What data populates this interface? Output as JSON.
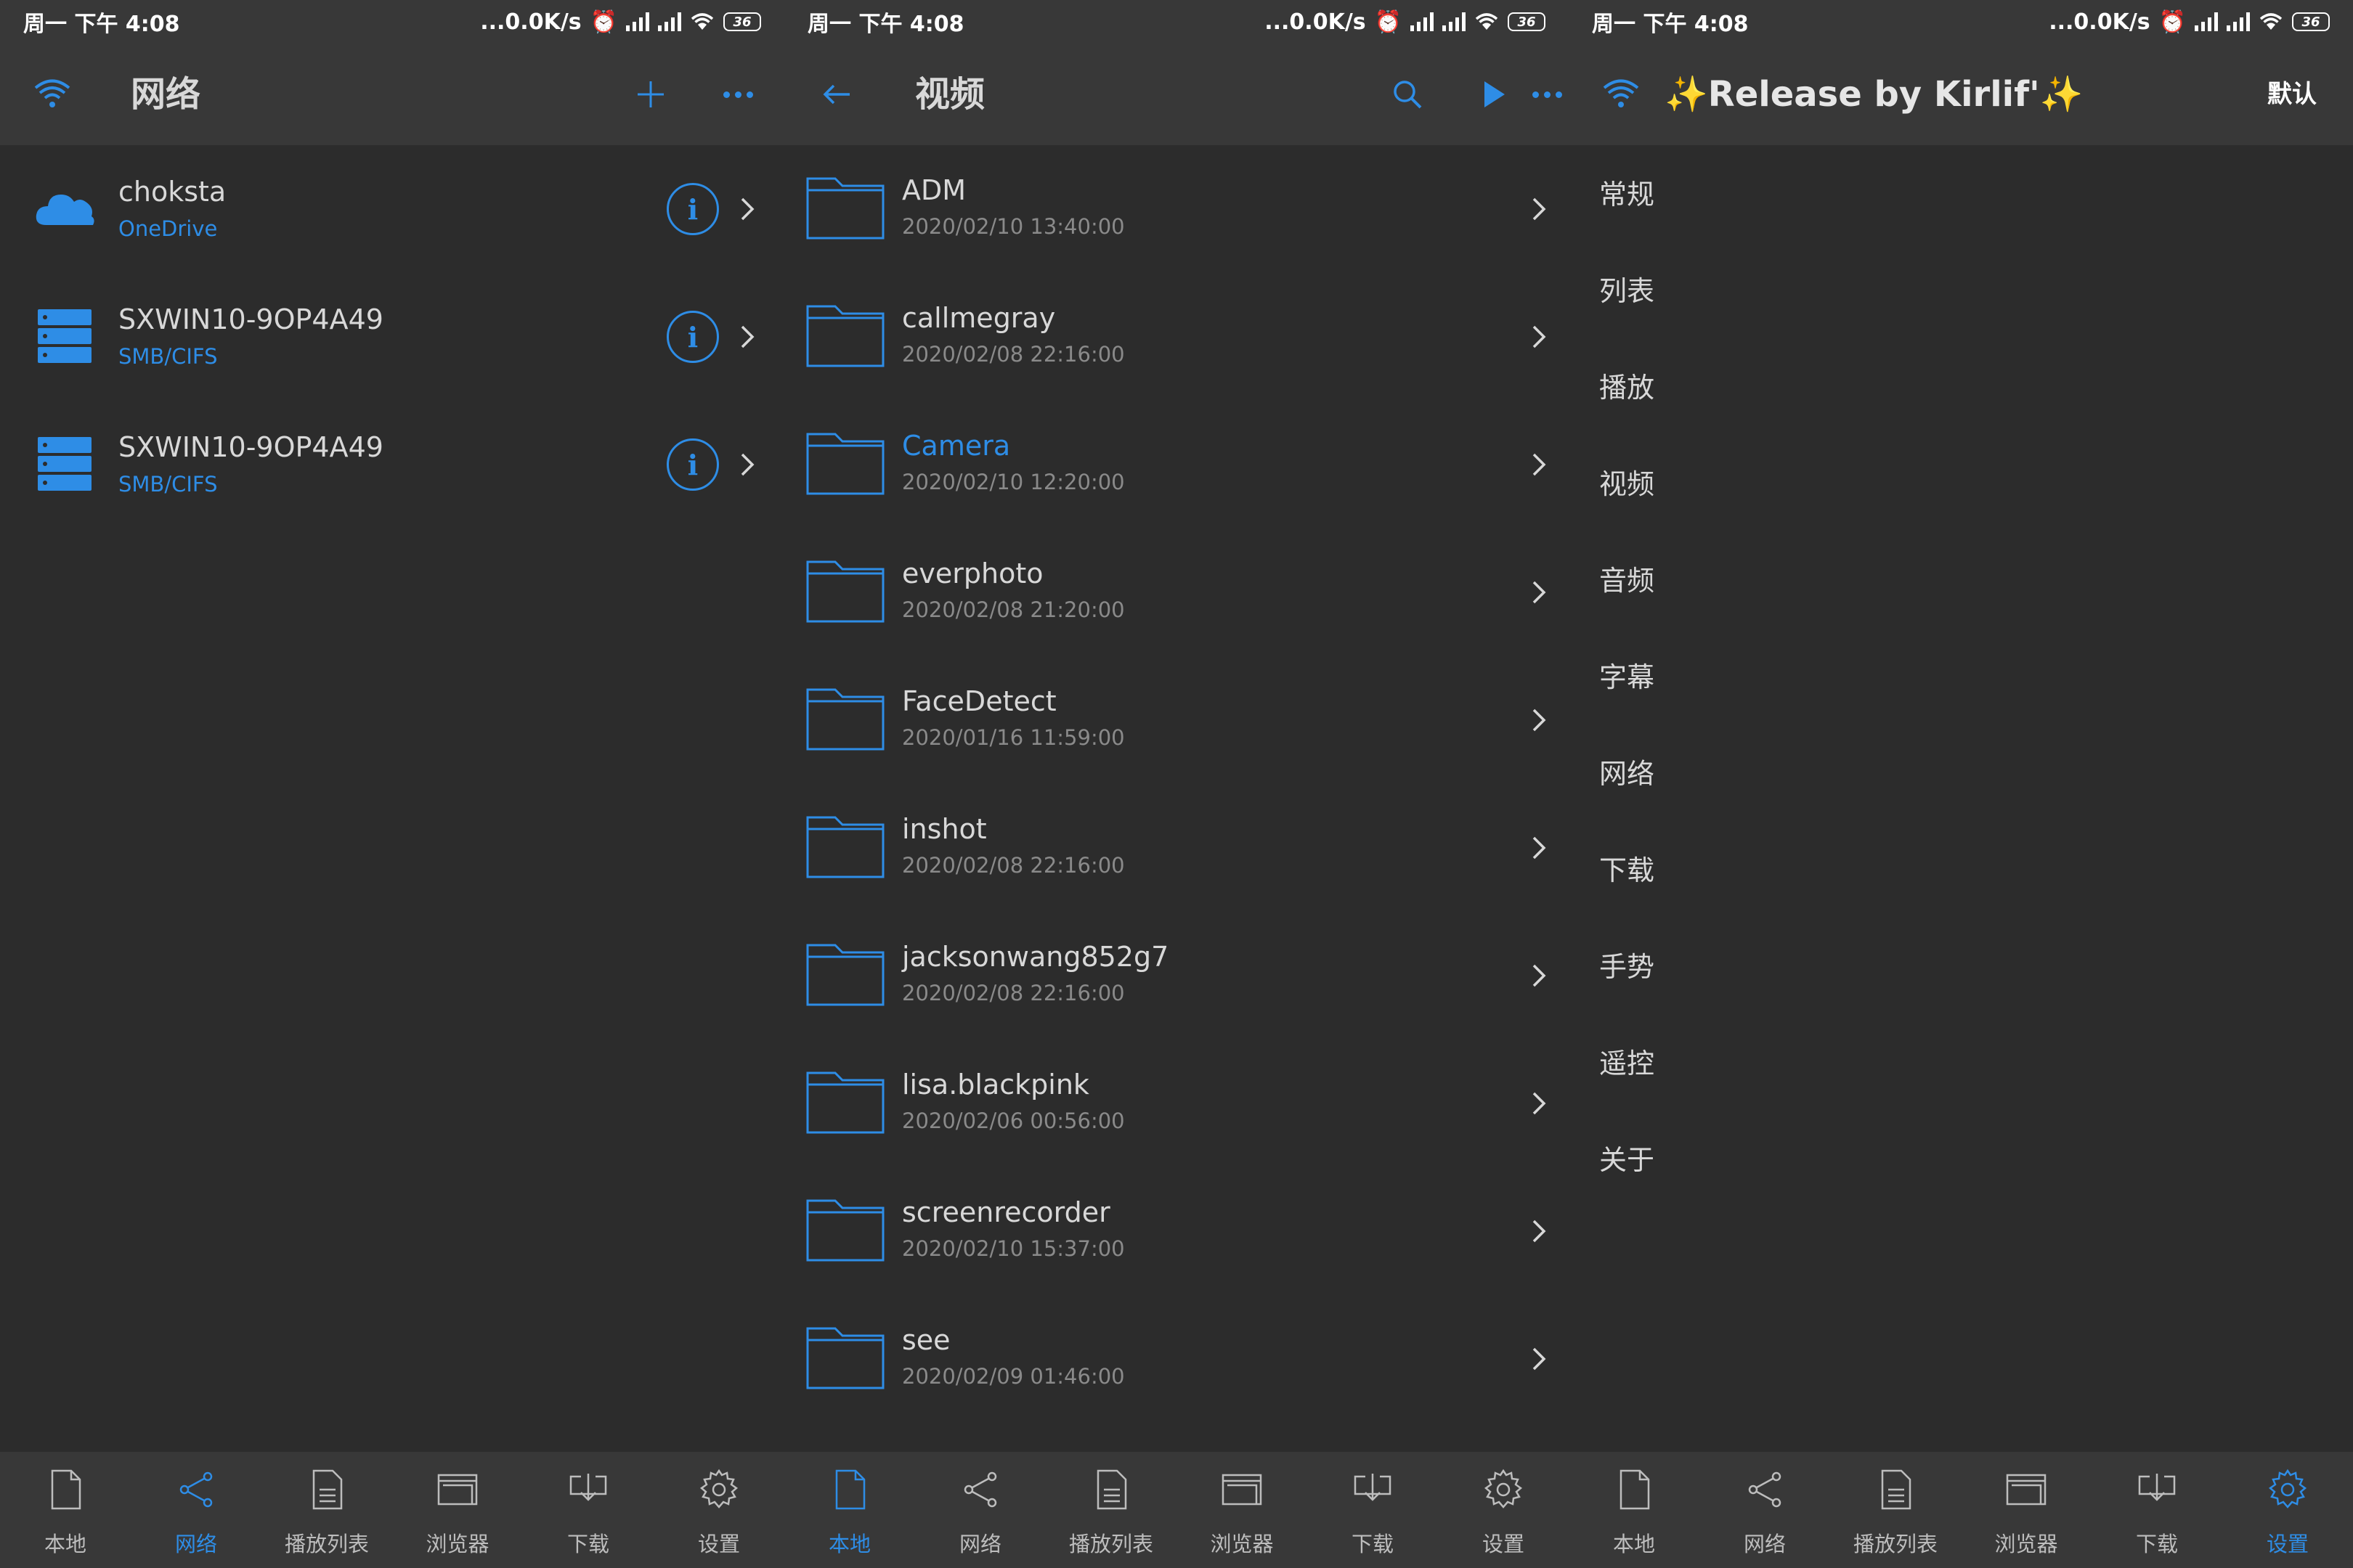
{
  "colors": {
    "accent": "#2e8de6",
    "bg": "#2c2c2c",
    "bar": "#383838",
    "text": "#d8d8d8",
    "muted": "#8a8a8a"
  },
  "status": {
    "time": "周一 下午 4:08",
    "speed": "...0.0K/s",
    "battery": "36"
  },
  "panel1": {
    "title": "网络",
    "items": [
      {
        "name": "choksta",
        "type": "OneDrive",
        "icon": "cloud-icon"
      },
      {
        "name": "SXWIN10-9OP4A49",
        "type": "SMB/CIFS",
        "icon": "server-icon"
      },
      {
        "name": "SXWIN10-9OP4A49",
        "type": "SMB/CIFS",
        "icon": "server-icon"
      }
    ]
  },
  "panel2": {
    "title": "视频",
    "folders": [
      {
        "name": "ADM",
        "date": "2020/02/10 13:40:00"
      },
      {
        "name": "callmegray",
        "date": "2020/02/08 22:16:00"
      },
      {
        "name": "Camera",
        "date": "2020/02/10 12:20:00"
      },
      {
        "name": "everphoto",
        "date": "2020/02/08 21:20:00"
      },
      {
        "name": "FaceDetect",
        "date": "2020/01/16 11:59:00"
      },
      {
        "name": "inshot",
        "date": "2020/02/08 22:16:00"
      },
      {
        "name": "jacksonwang852g7",
        "date": "2020/02/08 22:16:00"
      },
      {
        "name": "lisa.blackpink",
        "date": "2020/02/06 00:56:00"
      },
      {
        "name": "screenrecorder",
        "date": "2020/02/10 15:37:00"
      },
      {
        "name": "see",
        "date": "2020/02/09 01:46:00"
      }
    ]
  },
  "panel3": {
    "title": "Release by Kirlif'",
    "sparkle": "✨",
    "default_label": "默认",
    "items": [
      "常规",
      "列表",
      "播放",
      "视频",
      "音频",
      "字幕",
      "网络",
      "下载",
      "手势",
      "遥控",
      "关于"
    ]
  },
  "nav": {
    "labels": [
      "本地",
      "网络",
      "播放列表",
      "浏览器",
      "下载",
      "设置"
    ]
  }
}
